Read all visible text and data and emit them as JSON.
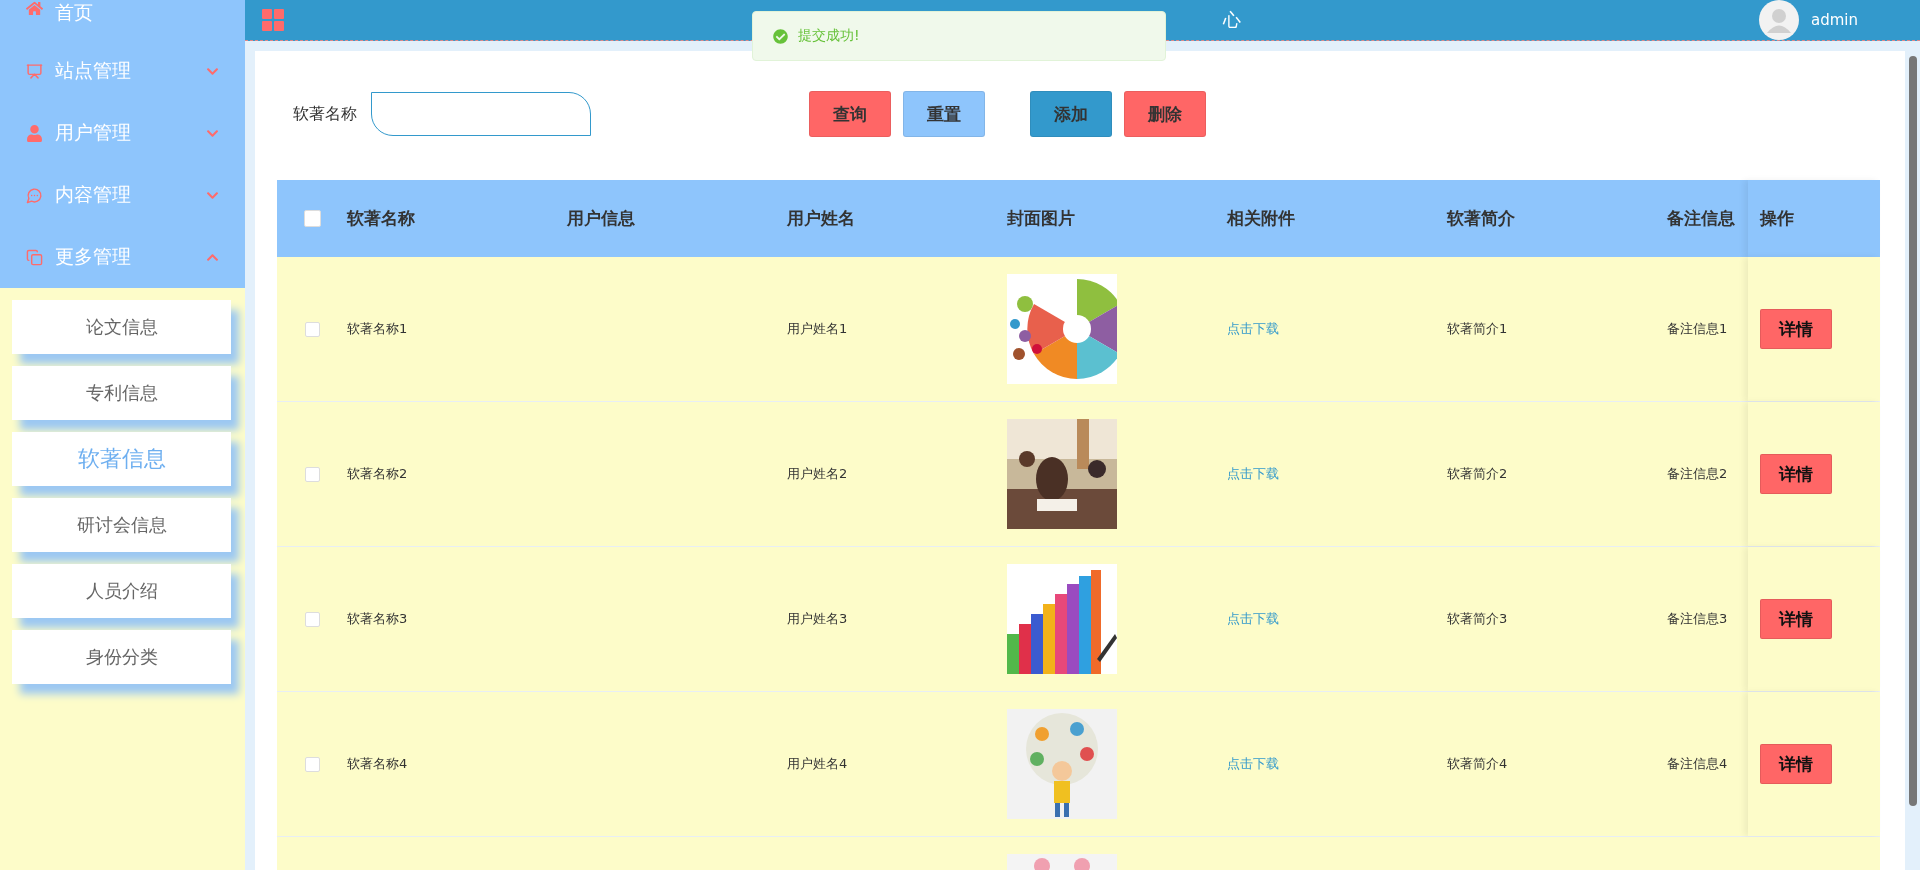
{
  "sidebar": {
    "menu": [
      {
        "label": "首页"
      },
      {
        "label": "站点管理",
        "expanded": false
      },
      {
        "label": "用户管理",
        "expanded": false
      },
      {
        "label": "内容管理",
        "expanded": false
      },
      {
        "label": "更多管理",
        "expanded": true
      }
    ],
    "submenu": [
      {
        "label": "论文信息",
        "selected": false
      },
      {
        "label": "专利信息",
        "selected": false
      },
      {
        "label": "软著信息",
        "selected": true
      },
      {
        "label": "研讨会信息",
        "selected": false
      },
      {
        "label": "人员介绍",
        "selected": false
      },
      {
        "label": "身份分类",
        "selected": false
      }
    ]
  },
  "header": {
    "title": "心",
    "user": "admin"
  },
  "toast": {
    "message": "提交成功!"
  },
  "search": {
    "label": "软著名称"
  },
  "buttons": [
    {
      "label": "查询",
      "kind": "danger"
    },
    {
      "label": "重置",
      "kind": "light"
    },
    {
      "label": "添加",
      "kind": "primary"
    },
    {
      "label": "删除",
      "kind": "danger"
    }
  ],
  "table": {
    "select_all": {
      "checked": false
    },
    "columns": [
      "软著名称",
      "用户信息",
      "用户姓名",
      "封面图片",
      "相关附件",
      "软著简介",
      "备注信息",
      "操作"
    ],
    "rows": [
      {
        "checked": false,
        "name": "软著名称1",
        "user_name": "用户姓名1",
        "attachment": "点击下载",
        "intro": "软著简介1",
        "note": "备注信息1",
        "action": "详情"
      },
      {
        "checked": false,
        "name": "软著名称2",
        "user_name": "用户姓名2",
        "attachment": "点击下载",
        "intro": "软著简介2",
        "note": "备注信息2",
        "action": "详情"
      },
      {
        "checked": false,
        "name": "软著名称3",
        "user_name": "用户姓名3",
        "attachment": "点击下载",
        "intro": "软著简介3",
        "note": "备注信息3",
        "action": "详情"
      },
      {
        "checked": false,
        "name": "软著名称4",
        "user_name": "用户姓名4",
        "attachment": "点击下载",
        "intro": "软著简介4",
        "note": "备注信息4",
        "action": "详情"
      }
    ]
  }
}
